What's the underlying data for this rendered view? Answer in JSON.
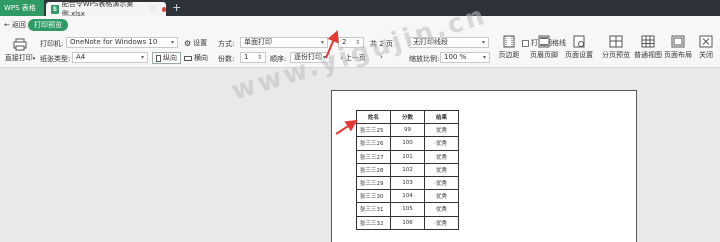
{
  "app": {
    "name": "WPS 表格",
    "file_tab": "配合令WPS表格演示案例.xlsx",
    "file_icon": "S"
  },
  "nav": {
    "back": "返回",
    "preview_badge": "打印预览"
  },
  "print": {
    "direct_print": "直接打印",
    "printer_label": "打印机:",
    "printer_value": "OneNote for Windows 10",
    "settings": "设置",
    "paper_label": "纸张类型:",
    "paper_value": "A4",
    "portrait": "纵向",
    "landscape": "横向",
    "mode_label": "方式:",
    "mode_value": "单面打印",
    "copies_label": "份数:",
    "copies_value": "1",
    "order_label": "顺序:",
    "order_value": "逐份打印",
    "page_current": "2",
    "page_total": "共 2 页",
    "prev_page": "上一页",
    "area_value": "无打印线段",
    "gridlines": "打印网格线",
    "zoom_label": "缩放比例:",
    "zoom_value": "100 %"
  },
  "toolbar_buttons": [
    "页边距",
    "页眉页脚",
    "页面设置",
    "分页预览",
    "普通视图",
    "页面布局",
    "关闭"
  ],
  "table": {
    "headers": [
      "姓名",
      "分数",
      "结果"
    ],
    "rows": [
      [
        "张三三25",
        "99",
        "优秀"
      ],
      [
        "张三三26",
        "100",
        "优秀"
      ],
      [
        "张三三27",
        "101",
        "优秀"
      ],
      [
        "张三三28",
        "102",
        "优秀"
      ],
      [
        "张三三29",
        "103",
        "优秀"
      ],
      [
        "张三三30",
        "104",
        "优秀"
      ],
      [
        "张三三31",
        "105",
        "优秀"
      ],
      [
        "张三三32",
        "106",
        "优秀"
      ]
    ]
  },
  "watermark": "www.yigujin.cn",
  "colors": {
    "accent": "#2f9a64",
    "arrow": "#e53935"
  }
}
